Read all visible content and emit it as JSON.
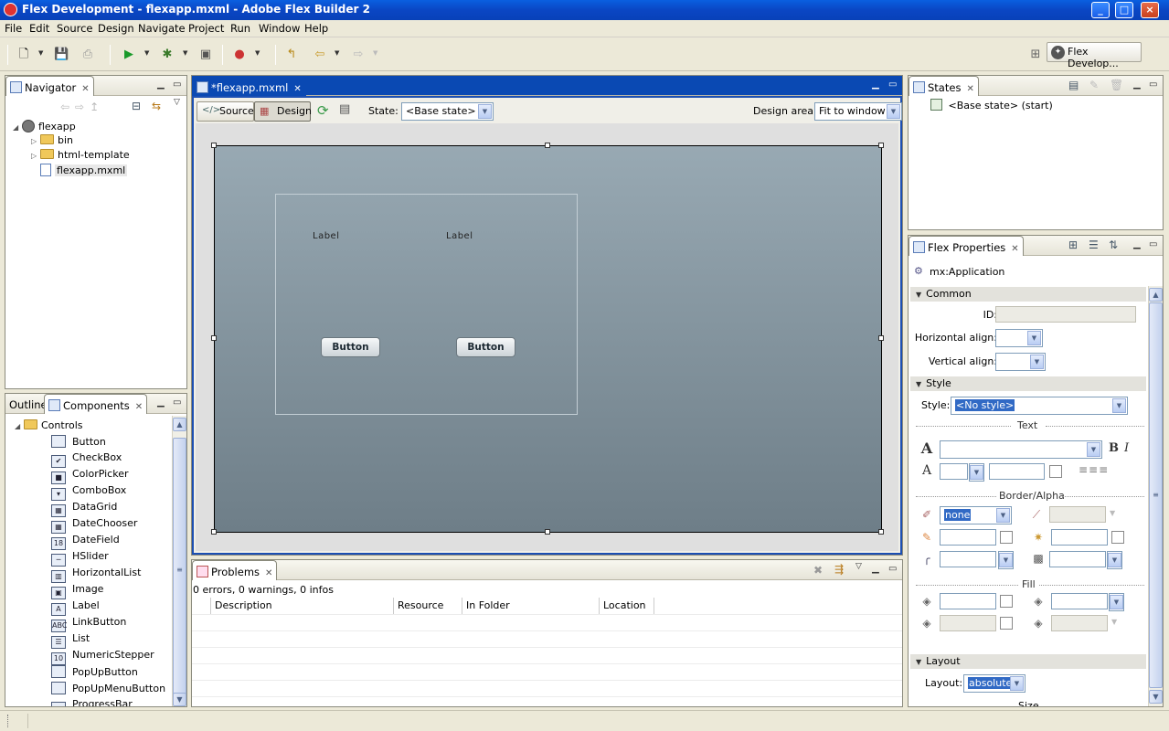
{
  "window": {
    "title": "Flex Development - flexapp.mxml - Adobe Flex Builder 2"
  },
  "menu": [
    "File",
    "Edit",
    "Source",
    "Design",
    "Navigate",
    "Project",
    "Run",
    "Window",
    "Help"
  ],
  "perspective": {
    "label": "Flex Develop..."
  },
  "navigator": {
    "tab": "Navigator",
    "tree": [
      {
        "label": "flexapp",
        "type": "project"
      },
      {
        "label": "bin",
        "type": "folder"
      },
      {
        "label": "html-template",
        "type": "folder"
      },
      {
        "label": "flexapp.mxml",
        "type": "file"
      }
    ]
  },
  "components": {
    "tabs": [
      "Outline",
      "Components"
    ],
    "group": "Controls",
    "items": [
      {
        "label": "Button",
        "icon": "button-icon"
      },
      {
        "label": "CheckBox",
        "icon": "checkbox-icon"
      },
      {
        "label": "ColorPicker",
        "icon": "colorpicker-icon"
      },
      {
        "label": "ComboBox",
        "icon": "combobox-icon"
      },
      {
        "label": "DataGrid",
        "icon": "datagrid-icon"
      },
      {
        "label": "DateChooser",
        "icon": "datechooser-icon"
      },
      {
        "label": "DateField",
        "icon": "datefield-icon"
      },
      {
        "label": "HSlider",
        "icon": "hslider-icon"
      },
      {
        "label": "HorizontalList",
        "icon": "horizontallist-icon"
      },
      {
        "label": "Image",
        "icon": "image-icon"
      },
      {
        "label": "Label",
        "icon": "label-icon"
      },
      {
        "label": "LinkButton",
        "icon": "linkbutton-icon"
      },
      {
        "label": "List",
        "icon": "list-icon"
      },
      {
        "label": "NumericStepper",
        "icon": "numericstepper-icon"
      },
      {
        "label": "PopUpButton",
        "icon": "popupbutton-icon"
      },
      {
        "label": "PopUpMenuButton",
        "icon": "popupmenubutton-icon"
      },
      {
        "label": "ProgressBar",
        "icon": "progressbar-icon"
      }
    ]
  },
  "editor": {
    "tab": "*flexapp.mxml",
    "source_label": "Source",
    "design_label": "Design",
    "state_label": "State:",
    "state_value": "<Base state>",
    "design_area_label": "Design area:",
    "design_area_value": "Fit to window",
    "canvas": {
      "labels": [
        "Label",
        "Label"
      ],
      "buttons": [
        "Button",
        "Button"
      ]
    }
  },
  "problems": {
    "tab": "Problems",
    "summary": "0 errors, 0 warnings, 0 infos",
    "columns": [
      "Description",
      "Resource",
      "In Folder",
      "Location"
    ]
  },
  "states": {
    "tab": "States",
    "items": [
      "<Base state> (start)"
    ]
  },
  "properties": {
    "tab": "Flex Properties",
    "component": "mx:Application",
    "common": {
      "title": "Common",
      "id_label": "ID:",
      "halign_label": "Horizontal align:",
      "valign_label": "Vertical align:"
    },
    "style": {
      "title": "Style",
      "style_label": "Style:",
      "style_value": "<No style>",
      "text_title": "Text",
      "bold": "B",
      "italic": "I",
      "border_title": "Border/Alpha",
      "border_value": "none",
      "fill_title": "Fill"
    },
    "layout": {
      "title": "Layout",
      "layout_label": "Layout:",
      "layout_value": "absolute",
      "size_partial": "Size"
    }
  }
}
